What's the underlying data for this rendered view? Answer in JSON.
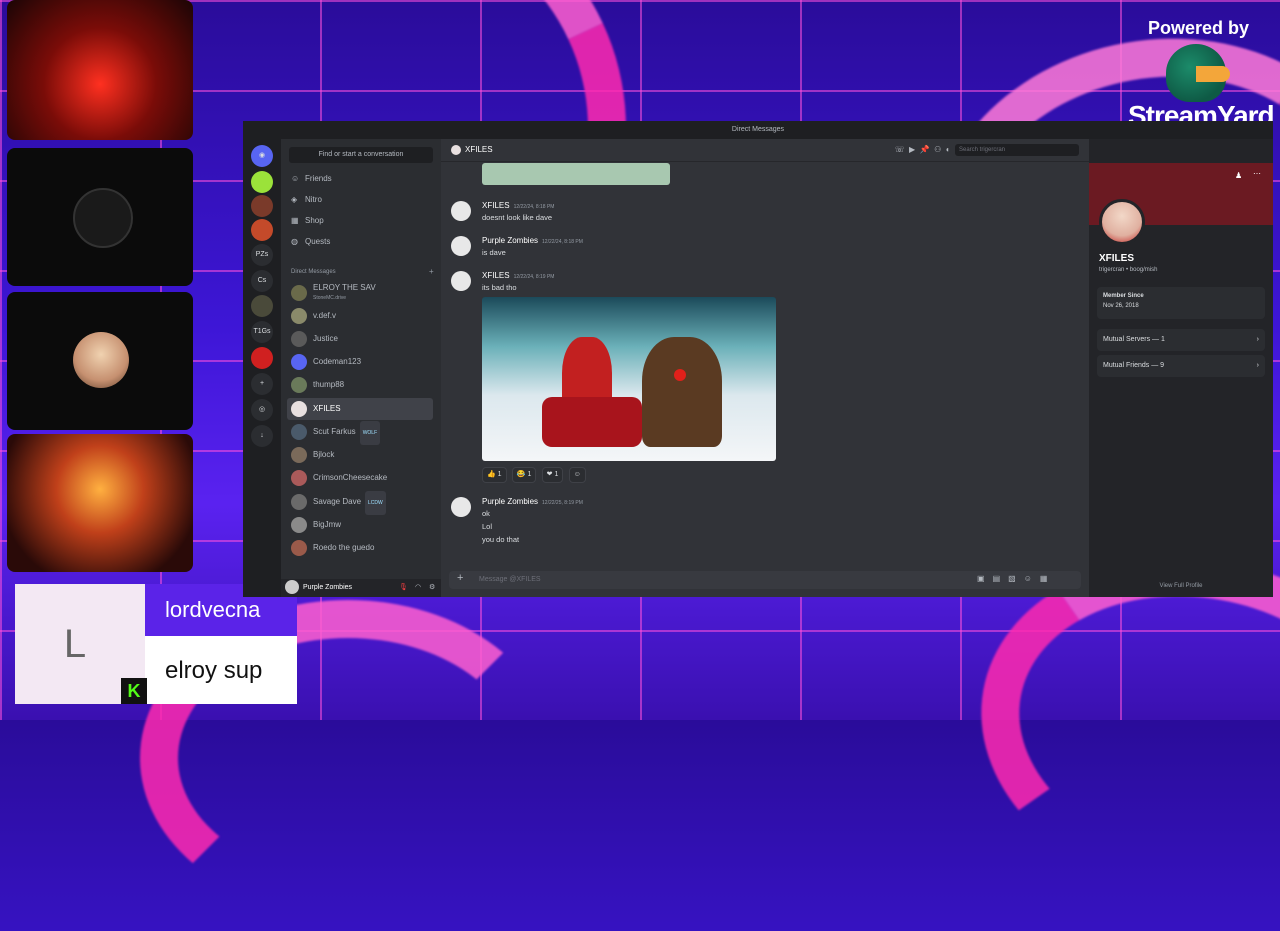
{
  "stream": {
    "powered_by": "Powered by",
    "brand": "StreamYard",
    "chat": {
      "initial": "L",
      "username": "lordvecna",
      "message": "elroy sup",
      "platform_icon": "kick-icon",
      "kick_glyph": "K"
    }
  },
  "discord": {
    "window_title": "Direct Messages",
    "search_placeholder": "Find or start a conversation",
    "nav": [
      {
        "label": "Friends"
      },
      {
        "label": "Nitro"
      },
      {
        "label": "Shop"
      },
      {
        "label": "Quests"
      }
    ],
    "dm_header": "Direct Messages",
    "servers": [
      "PZs",
      "Cs",
      "T1Gs"
    ],
    "dms": [
      {
        "name": "ELROY THE SAV",
        "sub": "StoneMC.drive"
      },
      {
        "name": "v.def.v"
      },
      {
        "name": "Justice"
      },
      {
        "name": "Codeman123"
      },
      {
        "name": "thump88"
      },
      {
        "name": "XFILES",
        "active": true
      },
      {
        "name": "Scut Farkus",
        "badge": "WOLF"
      },
      {
        "name": "Bjlock"
      },
      {
        "name": "CrimsonCheesecake"
      },
      {
        "name": "Savage Dave",
        "badge": "LCDW"
      },
      {
        "name": "BigJmw"
      },
      {
        "name": "Roedo the guedo"
      }
    ],
    "user": {
      "name": "Purple Zombies"
    },
    "channel": {
      "name": "XFILES",
      "search_placeholder": "Search trigercran"
    },
    "messages": [
      {
        "author": "XFILES",
        "time": "12/22/24, 8:18 PM",
        "lines": [
          "doesnt look like dave"
        ]
      },
      {
        "author": "Purple Zombies",
        "time": "12/22/24, 8:18 PM",
        "lines": [
          "is dave"
        ]
      },
      {
        "author": "XFILES",
        "time": "12/22/24, 8:19 PM",
        "lines": [
          "its bad tho"
        ]
      },
      {
        "author": "Purple Zombies",
        "time": "12/22/25, 8:19 PM",
        "lines": [
          "ok",
          "Lol",
          "you do that"
        ]
      }
    ],
    "reactions": [
      {
        "emoji": "👍",
        "count": "1"
      },
      {
        "emoji": "😂",
        "count": "1"
      },
      {
        "emoji": "❤",
        "count": "1"
      }
    ],
    "composer_placeholder": "Message @XFILES",
    "profile": {
      "name": "XFILES",
      "tag": "trigercran • boog/mish",
      "member_since_label": "Member Since",
      "member_since": "Nov 26, 2018",
      "mutual_servers": "Mutual Servers — 1",
      "mutual_friends": "Mutual Friends — 9",
      "view_full": "View Full Profile"
    }
  }
}
